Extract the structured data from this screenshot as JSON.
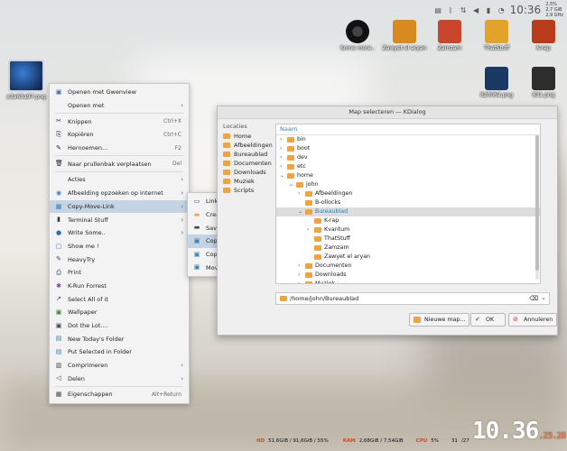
{
  "desktop": {
    "left_icon_label": "a3a63a97.png",
    "icons": [
      {
        "label": "Some more..",
        "color": "#2b2b2b"
      },
      {
        "label": "Zawyet el aryan",
        "color": "#d88a1e"
      },
      {
        "label": "Zamzam",
        "color": "#c9452b"
      },
      {
        "label": "ThatStuff",
        "color": "#e2a32a"
      },
      {
        "label": "K-rap",
        "color": "#b83c1c"
      },
      {
        "label": "820062.png",
        "color": "#1b3a63"
      },
      {
        "label": "831.png",
        "color": "#2d2d2d"
      }
    ]
  },
  "tray": {
    "clock": "10:36",
    "stat1": "2,5%",
    "stat2": "2,7 GiB",
    "stat3": "2,9 GHz"
  },
  "context_menu": {
    "items": [
      {
        "label": "Openen met Gwenview",
        "icon": "gwenview-icon",
        "glyph": "▣",
        "color": "#3a6fb0"
      },
      {
        "label": "Openen met",
        "arrow": "›"
      },
      {
        "sep": true
      },
      {
        "label": "Knippen",
        "shortcut": "Ctrl+X",
        "glyph": "✂"
      },
      {
        "label": "Kopiëren",
        "shortcut": "Ctrl+C",
        "glyph": "⎘"
      },
      {
        "label": "Hernoemen...",
        "shortcut": "F2",
        "glyph": "✎"
      },
      {
        "sep": true
      },
      {
        "label": "Naar prullenbak verplaatsen",
        "shortcut": "Del",
        "glyph": "🗑"
      },
      {
        "sep": true
      },
      {
        "label": "Acties",
        "arrow": "›"
      },
      {
        "label": "Afbeelding opzoeken op internet",
        "arrow": "›",
        "glyph": "◉",
        "color": "#3b7fd4"
      },
      {
        "label": "Copy-Move-Link",
        "arrow": "›",
        "glyph": "▦",
        "color": "#2e7fb8",
        "highlight": true
      },
      {
        "label": "Terminal Stuff",
        "arrow": "›",
        "glyph": "▮",
        "color": "#333"
      },
      {
        "label": "Write Some..",
        "arrow": "›",
        "glyph": "●",
        "color": "#2c6fb0"
      },
      {
        "label": "Show me !",
        "glyph": "▢",
        "color": "#2c6fb0"
      },
      {
        "label": "HeavyTry",
        "glyph": "✎",
        "color": "#444"
      },
      {
        "label": "Print",
        "glyph": "⎙",
        "color": "#444"
      },
      {
        "label": "K-Run Forrest",
        "glyph": "✱",
        "color": "#7a3fb0"
      },
      {
        "label": "Select All of it",
        "glyph": "↗",
        "color": "#444"
      },
      {
        "label": "Wallpaper",
        "glyph": "▣",
        "color": "#3b8a3b"
      },
      {
        "label": "Dot the Lot....",
        "glyph": "▣",
        "color": "#444"
      },
      {
        "label": "New Today's Folder",
        "glyph": "▤",
        "color": "#2e7fb8"
      },
      {
        "label": "Put Selected in Folder",
        "glyph": "▤",
        "color": "#2e7fb8"
      },
      {
        "label": "Comprimeren",
        "arrow": "›",
        "glyph": "▥",
        "color": "#444"
      },
      {
        "label": "Delen",
        "arrow": "›",
        "glyph": "◁",
        "color": "#444"
      },
      {
        "sep": true
      },
      {
        "label": "Eigenschappen",
        "shortcut": "Alt+Return",
        "glyph": "▦",
        "color": "#444"
      }
    ]
  },
  "submenu": {
    "items": [
      {
        "label": "Link It To..",
        "glyph": "▭",
        "color": "#444"
      },
      {
        "label": "Create Link to Desktop",
        "glyph": "▬",
        "color": "#f0a440"
      },
      {
        "label": "Save in directory..",
        "glyph": "▬",
        "color": "#444"
      },
      {
        "label": "Copy It To..",
        "glyph": "▣",
        "color": "#2e7fb8",
        "highlight": true
      },
      {
        "label": "Copy & Date..",
        "glyph": "▣",
        "color": "#2e7fb8"
      },
      {
        "label": "Move It To..",
        "glyph": "▣",
        "color": "#2e7fb8"
      }
    ]
  },
  "dialog": {
    "title": "Map selecteren — KDialog",
    "places_header": "Locaties",
    "places": [
      "Home",
      "Afbeeldingen",
      "Bureaublad",
      "Documenten",
      "Downloads",
      "Muziek",
      "Scripts"
    ],
    "tree_header": "Naam",
    "tree": [
      {
        "label": "bin",
        "level": 0,
        "toggle": "›"
      },
      {
        "label": "boot",
        "level": 0,
        "toggle": "›"
      },
      {
        "label": "dev",
        "level": 0,
        "toggle": "›"
      },
      {
        "label": "etc",
        "level": 0,
        "toggle": "›"
      },
      {
        "label": "home",
        "level": 0,
        "toggle": "⌄"
      },
      {
        "label": "john",
        "level": 1,
        "toggle": "⌄"
      },
      {
        "label": "Afbeeldingen",
        "level": 2,
        "toggle": "›"
      },
      {
        "label": "B-ollocks",
        "level": 2,
        "toggle": ""
      },
      {
        "label": "Bureaublad",
        "level": 2,
        "toggle": "⌄",
        "selected": true
      },
      {
        "label": "K-rap",
        "level": 3,
        "toggle": ""
      },
      {
        "label": "Kvantum",
        "level": 3,
        "toggle": "›"
      },
      {
        "label": "ThatStuff",
        "level": 3,
        "toggle": ""
      },
      {
        "label": "Zamzam",
        "level": 3,
        "toggle": ""
      },
      {
        "label": "Zawyet el aryan",
        "level": 3,
        "toggle": ""
      },
      {
        "label": "Documenten",
        "level": 2,
        "toggle": "›"
      },
      {
        "label": "Downloads",
        "level": 2,
        "toggle": "›"
      },
      {
        "label": "Muziek",
        "level": 2,
        "toggle": "›"
      }
    ],
    "path": "/home/john/Bureaublad",
    "buttons": {
      "new_folder": "Nieuwe map...",
      "ok": "OK",
      "cancel": "Annuleren"
    }
  },
  "bottom": {
    "hd_label": "HD",
    "hd_value": "51,6GiB / 91,6GiB / 55%",
    "ram_label": "RAM",
    "ram_value": "2,68GiB / 7,54GiB",
    "cpu_label": "CPU",
    "cpu_value": "5%",
    "temp_value": "31",
    "temp_value2": "/27",
    "clock_big": "10.36",
    "clock_small1": "25",
    "clock_small2": "28"
  }
}
